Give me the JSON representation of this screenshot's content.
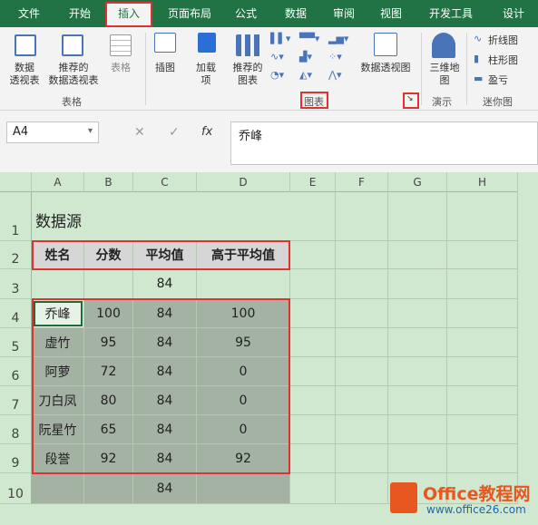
{
  "tabs": [
    "文件",
    "开始",
    "插入",
    "页面布局",
    "公式",
    "数据",
    "审阅",
    "视图",
    "开发工具",
    "设计"
  ],
  "ribbon": {
    "pivot": "数据\n透视表",
    "rec_pivot": "推荐的\n数据透视表",
    "table": "表格",
    "group_table": "表格",
    "illust": "插图",
    "addin": "加载\n项",
    "rec_chart": "推荐的\n图表",
    "pivot_chart": "数据透视图",
    "group_chart": "图表",
    "map3d": "三维地\n图",
    "group_demo": "演示",
    "spark_line": "折线图",
    "spark_col": "柱形图",
    "spark_wl": "盈亏",
    "group_spark": "迷你图"
  },
  "formula": {
    "name_box": "A4",
    "fx": "fx",
    "content": "乔峰"
  },
  "columns": [
    "A",
    "B",
    "C",
    "D",
    "E",
    "F",
    "G",
    "H"
  ],
  "rows": [
    "1",
    "2",
    "3",
    "4",
    "5",
    "6",
    "7",
    "8",
    "9",
    "10"
  ],
  "title": "数据源",
  "headers": [
    "姓名",
    "分数",
    "平均值",
    "高于平均值"
  ],
  "avg_row3": "84",
  "data": [
    [
      "乔峰",
      "100",
      "84",
      "100"
    ],
    [
      "虚竹",
      "95",
      "84",
      "95"
    ],
    [
      "阿萝",
      "72",
      "84",
      "0"
    ],
    [
      "刀白凤",
      "80",
      "84",
      "0"
    ],
    [
      "阮星竹",
      "65",
      "84",
      "0"
    ],
    [
      "段誉",
      "92",
      "84",
      "92"
    ]
  ],
  "avg_row10": "84",
  "watermark": {
    "brand": "Office教程网",
    "url": "www.office26.com"
  }
}
